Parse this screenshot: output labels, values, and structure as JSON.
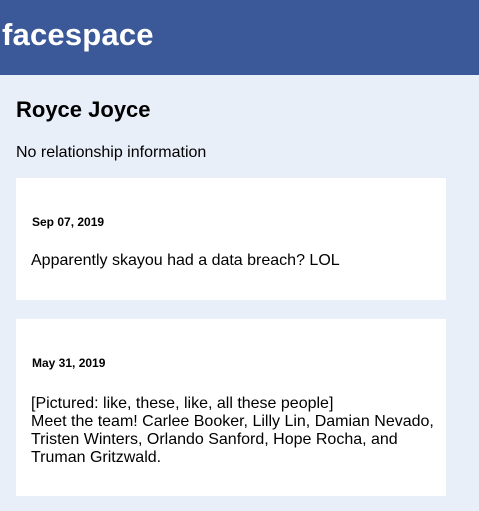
{
  "header": {
    "brand": "facespace"
  },
  "profile": {
    "name": "Royce Joyce",
    "relationship": "No relationship information"
  },
  "posts": [
    {
      "date": "Sep 07, 2019",
      "text": "Apparently skayou had a data breach? LOL"
    },
    {
      "date": "May 31, 2019",
      "caption": "[Pictured: like, these, like, all these people]",
      "text": "Meet the team! Carlee Booker, Lilly Lin, Damian Nevado, Tristen Winters, Orlando Sanford, Hope Rocha, and Truman Gritzwald."
    }
  ]
}
